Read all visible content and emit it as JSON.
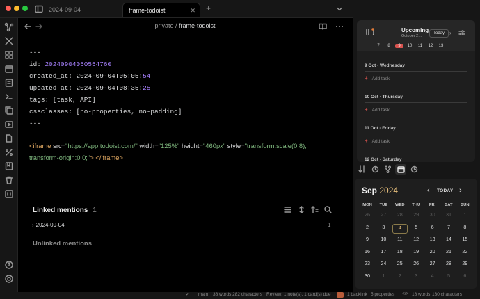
{
  "tabs": {
    "inactive": "2024-09-04",
    "active": "frame-todoist",
    "close": "✕",
    "new": "+"
  },
  "header": {
    "folder": "private",
    "sep": "/",
    "title": "frame-todoist"
  },
  "frontmatter": {
    "open": "---",
    "id_key": "id:",
    "id_val": "20240904050554760",
    "created_key": "created_at:",
    "created_prefix": "2024-09-04T05:05:",
    "created_sec": "54",
    "updated_key": "updated_at:",
    "updated_prefix": "2024-09-04T08:35:",
    "updated_sec": "25",
    "tags_key": "tags:",
    "tags_val": "[task, API]",
    "css_key": "cssclasses:",
    "css_val": "[no-properties, no-padding]",
    "close": "---"
  },
  "iframe": {
    "open": "<iframe",
    "src_attr": "src=",
    "src_val": "\"https://app.todoist.com/\"",
    "width_attr": "width=",
    "width_val": "\"125%\"",
    "height_attr": "height=",
    "height_val": "\"460px\"",
    "style_attr": "style=",
    "style_val_1": "\"transform:scale(0.8);",
    "style_val_2": "transform-origin:0 0;\"",
    "gt": ">",
    "close": "</iframe>"
  },
  "backlinks": {
    "linked_title": "Linked mentions",
    "linked_count": "1",
    "item": "2024-09-04",
    "item_count": "1",
    "unlinked_title": "Unlinked mentions"
  },
  "todoist": {
    "title": "Upcoming",
    "month": "October 2…",
    "today": "Today",
    "days": [
      "7",
      "8",
      "9",
      "10",
      "11",
      "12",
      "13"
    ],
    "selected_day": "9",
    "sections": [
      {
        "title": "9 Oct · Wednesday",
        "add": "Add task"
      },
      {
        "title": "10 Oct · Thursday",
        "add": "Add task"
      },
      {
        "title": "11 Oct · Friday",
        "add": "Add task"
      },
      {
        "title": "12 Oct · Saturday",
        "add": ""
      }
    ]
  },
  "calendar": {
    "month": "Sep",
    "year": "2024",
    "today_btn": "TODAY",
    "weekdays": [
      "MON",
      "TUE",
      "WED",
      "THU",
      "FRI",
      "SAT",
      "SUN"
    ],
    "weeks": [
      [
        "26",
        "27",
        "28",
        "29",
        "30",
        "31",
        "1"
      ],
      [
        "2",
        "3",
        "4",
        "5",
        "6",
        "7",
        "8"
      ],
      [
        "9",
        "10",
        "11",
        "12",
        "13",
        "14",
        "15"
      ],
      [
        "16",
        "17",
        "18",
        "19",
        "20",
        "21",
        "22"
      ],
      [
        "23",
        "24",
        "25",
        "26",
        "27",
        "28",
        "29"
      ],
      [
        "30",
        "1",
        "2",
        "3",
        "4",
        "5",
        "6"
      ]
    ],
    "today": "4"
  },
  "status": {
    "branch": "main",
    "words": "38 words 282 characters",
    "review": "Review: 1 note(s), 1 card(s) due",
    "backlinks": "1 backlink",
    "properties": "5 properties",
    "words2": "18 words",
    "chars2": "130 characters"
  },
  "colors": {
    "accent": "#a882ff",
    "today_red": "#d9534f",
    "calendar_year": "#e8c07d"
  }
}
